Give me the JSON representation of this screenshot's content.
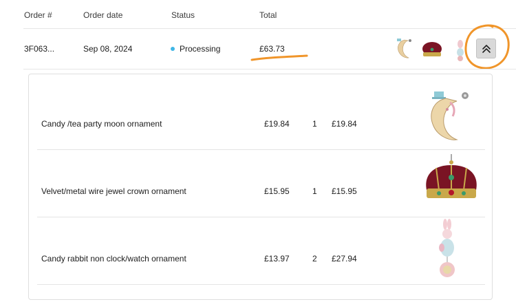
{
  "table": {
    "headers": {
      "order_num": "Order #",
      "order_date": "Order date",
      "status": "Status",
      "total": "Total"
    }
  },
  "order": {
    "number": "3F063...",
    "date": "Sep 08, 2024",
    "status": "Processing",
    "total": "£63.73",
    "status_color": "#3fb6e6",
    "toggle_icon": "chevron-double-up-icon"
  },
  "annotation": {
    "color": "#f0952a"
  },
  "items": [
    {
      "name": "Candy /tea party moon ornament",
      "price": "£19.84",
      "qty": "1",
      "line_total": "£19.84",
      "image": "moon-ornament"
    },
    {
      "name": "Velvet/metal wire jewel crown ornament",
      "price": "£15.95",
      "qty": "1",
      "line_total": "£15.95",
      "image": "crown-ornament"
    },
    {
      "name": "Candy rabbit non clock/watch ornament",
      "price": "£13.97",
      "qty": "2",
      "line_total": "£27.94",
      "image": "rabbit-ornament"
    }
  ]
}
